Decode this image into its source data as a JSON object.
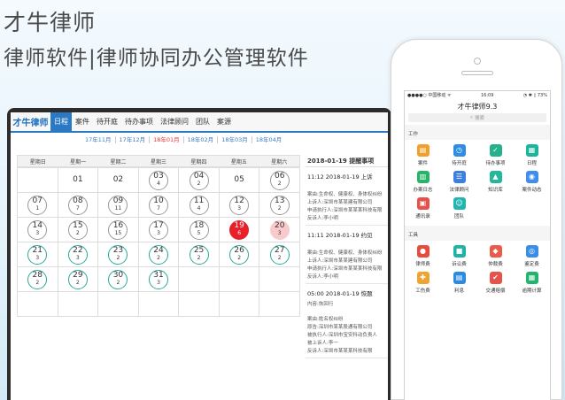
{
  "hero": {
    "title": "才牛律师",
    "subtitle": "律师软件|律师协同办公管理软件"
  },
  "desktop": {
    "logo": "才牛律师",
    "nav": [
      "日程",
      "案件",
      "待开庭",
      "待办事项",
      "法律顾问",
      "团队",
      "案源"
    ],
    "months": [
      "17年11月",
      "17年12月",
      "18年01月",
      "18年02月",
      "18年03月",
      "18年04月"
    ],
    "weekdays": [
      "星期日",
      "星期一",
      "星期二",
      "星期三",
      "星期四",
      "星期五",
      "星期六"
    ],
    "days": [
      {
        "d": "",
        "c": "",
        "t": "empty"
      },
      {
        "d": "01",
        "c": "",
        "t": "plain"
      },
      {
        "d": "02",
        "c": "",
        "t": "plain"
      },
      {
        "d": "03",
        "c": "4",
        "t": "gray"
      },
      {
        "d": "04",
        "c": "2",
        "t": "gray"
      },
      {
        "d": "05",
        "c": "",
        "t": "plain"
      },
      {
        "d": "06",
        "c": "2",
        "t": "gray"
      },
      {
        "d": "07",
        "c": "1",
        "t": "gray"
      },
      {
        "d": "08",
        "c": "7",
        "t": "gray"
      },
      {
        "d": "09",
        "c": "11",
        "t": "gray"
      },
      {
        "d": "10",
        "c": "7",
        "t": "gray"
      },
      {
        "d": "11",
        "c": "4",
        "t": "gray"
      },
      {
        "d": "12",
        "c": "3",
        "t": "gray"
      },
      {
        "d": "13",
        "c": "2",
        "t": "gray"
      },
      {
        "d": "14",
        "c": "3",
        "t": "gray"
      },
      {
        "d": "15",
        "c": "2",
        "t": "gray"
      },
      {
        "d": "16",
        "c": "15",
        "t": "gray"
      },
      {
        "d": "17",
        "c": "3",
        "t": "gray"
      },
      {
        "d": "18",
        "c": "5",
        "t": "gray"
      },
      {
        "d": "19",
        "c": "6",
        "t": "red"
      },
      {
        "d": "20",
        "c": "3",
        "t": "pink"
      },
      {
        "d": "21",
        "c": "3",
        "t": "teal"
      },
      {
        "d": "22",
        "c": "3",
        "t": "teal"
      },
      {
        "d": "23",
        "c": "2",
        "t": "teal"
      },
      {
        "d": "24",
        "c": "2",
        "t": "teal"
      },
      {
        "d": "25",
        "c": "2",
        "t": "teal"
      },
      {
        "d": "26",
        "c": "2",
        "t": "teal"
      },
      {
        "d": "27",
        "c": "2",
        "t": "teal"
      },
      {
        "d": "28",
        "c": "2",
        "t": "teal"
      },
      {
        "d": "29",
        "c": "2",
        "t": "teal"
      },
      {
        "d": "30",
        "c": "2",
        "t": "teal"
      },
      {
        "d": "31",
        "c": "3",
        "t": "teal"
      },
      {
        "d": "",
        "c": "",
        "t": "empty"
      },
      {
        "d": "",
        "c": "",
        "t": "empty"
      },
      {
        "d": "",
        "c": "",
        "t": "empty"
      },
      {
        "d": "",
        "c": "",
        "t": "empty"
      },
      {
        "d": "",
        "c": "",
        "t": "empty"
      },
      {
        "d": "",
        "c": "",
        "t": "empty"
      },
      {
        "d": "",
        "c": "",
        "t": "empty"
      },
      {
        "d": "",
        "c": "",
        "t": "empty"
      },
      {
        "d": "",
        "c": "",
        "t": "empty"
      },
      {
        "d": "",
        "c": "",
        "t": "empty"
      }
    ],
    "schedule_title": "2018-01-19  提醒事项",
    "schedule": [
      {
        "head": "11:12  2018-01-19  上诉",
        "lines": [
          "",
          "案由:生命权、健康权、身体权纠纷",
          "上诉人:深圳市某某建有限公司",
          "申请执行人:深圳市某某某科技有限",
          "反诉人:李小明"
        ]
      },
      {
        "head": "11:11  2018-01-19  约见",
        "lines": [
          "",
          "案由:生命权、健康权、身体权纠纷",
          "上诉人:深圳市某某建有限公司",
          "申请执行人:深圳市某某某科技有限",
          "反诉人:李小明"
        ]
      },
      {
        "head": "05:00  2018-01-19  恢题",
        "lines": [
          "内容:恢回行",
          "",
          "案由:姓名权纠纷",
          "原告:深圳市某某股通有限公司",
          "被执行人:深圳市宝安科动负责人",
          "被上诉人:李一",
          "反诉人:深圳市某某某科技有限"
        ]
      }
    ]
  },
  "mobile": {
    "status_left": "●●●●○ 中国移动 ᯤ",
    "status_time": "16:09",
    "status_right": "◔ ✱ ▯ 73%",
    "title": "才牛律师9.3",
    "search_placeholder": "搜索",
    "work_label": "工作",
    "tools_label": "工具",
    "work_apps": [
      {
        "label": "案件",
        "color": "#f0a02a",
        "glyph": "▤",
        "name": "case-icon"
      },
      {
        "label": "待开庭",
        "color": "#2f8de4",
        "glyph": "◷",
        "name": "clock-icon"
      },
      {
        "label": "待办事项",
        "color": "#25b18b",
        "glyph": "✓",
        "name": "todo-icon"
      },
      {
        "label": "日程",
        "color": "#1cb49b",
        "glyph": "▦",
        "name": "calendar-icon"
      },
      {
        "label": "办案日志",
        "color": "#27b368",
        "glyph": "▥",
        "name": "log-icon"
      },
      {
        "label": "法律顾问",
        "color": "#3d7fe0",
        "glyph": "☰",
        "name": "advisor-icon"
      },
      {
        "label": "知识库",
        "color": "#23b79c",
        "glyph": "▲",
        "name": "knowledge-icon"
      },
      {
        "label": "案件动态",
        "color": "#3f8fe8",
        "glyph": "◉",
        "name": "dynamic-icon"
      },
      {
        "label": "通讯录",
        "color": "#e8504a",
        "glyph": "▣",
        "name": "contacts-icon"
      },
      {
        "label": "团队",
        "color": "#23b5b0",
        "glyph": "☺",
        "name": "team-icon"
      }
    ],
    "tool_apps": [
      {
        "label": "律师费",
        "color": "#e74c3c",
        "glyph": "●",
        "name": "lawyer-fee-icon"
      },
      {
        "label": "诉讼费",
        "color": "#1fb3a6",
        "glyph": "■",
        "name": "litigation-fee-icon"
      },
      {
        "label": "仲裁费",
        "color": "#ec5a4b",
        "glyph": "◆",
        "name": "arbitration-fee-icon"
      },
      {
        "label": "鉴定费",
        "color": "#3c8de6",
        "glyph": "◎",
        "name": "appraisal-fee-icon"
      },
      {
        "label": "工伤费",
        "color": "#f0a430",
        "glyph": "✚",
        "name": "injury-fee-icon"
      },
      {
        "label": "利息",
        "color": "#2c8be0",
        "glyph": "▤",
        "name": "interest-icon"
      },
      {
        "label": "交通赔偿",
        "color": "#e6534a",
        "glyph": "✔",
        "name": "traffic-icon"
      },
      {
        "label": "逾期计算",
        "color": "#22b36e",
        "glyph": "▦",
        "name": "overdue-icon"
      }
    ]
  }
}
